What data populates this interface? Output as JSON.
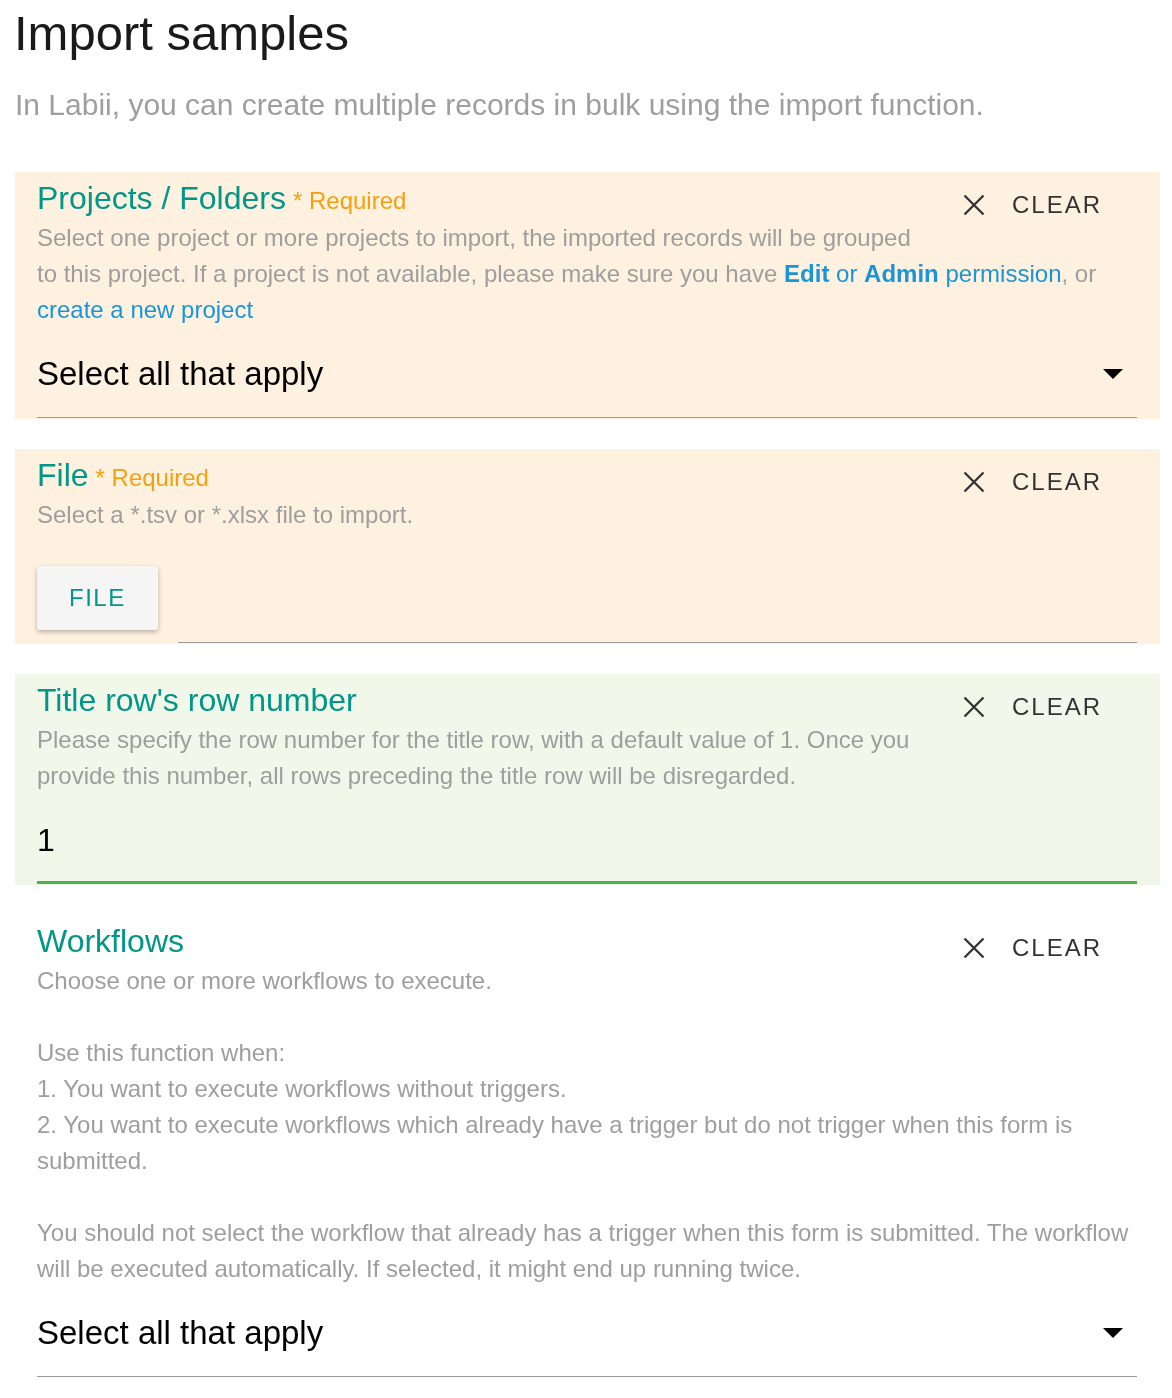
{
  "page": {
    "title": "Import samples",
    "subtitle": "In Labii, you can create multiple records in bulk using the import function."
  },
  "fields": [
    {
      "kind": "select",
      "title": "Projects / Folders",
      "required_label": "* Required",
      "color": "#fef1df",
      "focused": false,
      "clear_label": "CLEAR",
      "description": [
        {
          "kind": "rich",
          "segments": [
            {
              "kind": "text",
              "text": "Select one project or more projects to import, the imported records will be grouped to this project. If a project is not available, please make sure you have "
            },
            {
              "kind": "link",
              "text": "**Edit** or **Admin** permission"
            },
            {
              "kind": "text",
              "text": ", or "
            },
            {
              "kind": "link",
              "text": "create a new project"
            }
          ]
        }
      ],
      "placeholder": "Select all that apply"
    },
    {
      "kind": "file",
      "title": "File",
      "required_label": "* Required",
      "color": "#fef1df",
      "focused": false,
      "clear_label": "CLEAR",
      "description": [
        {
          "kind": "text",
          "lines": [
            "Select a *.tsv or *.xlsx file to import."
          ]
        }
      ],
      "button_label": "FILE"
    },
    {
      "kind": "number",
      "title": "Title row's row number",
      "color": "#f1f8e9",
      "focused": true,
      "clear_label": "CLEAR",
      "description": [
        {
          "kind": "text",
          "lines": [
            "Please specify the row number for the title row, with a default value of 1. Once you provide this number, all rows preceding the title row will be disregarded."
          ]
        }
      ],
      "value": "1"
    },
    {
      "kind": "select",
      "title": "Workflows",
      "color": "#ffffff",
      "focused": false,
      "clear_label": "CLEAR",
      "description": [
        {
          "kind": "text",
          "lines": [
            "Choose one or more workflows to execute."
          ]
        },
        {
          "kind": "text",
          "lines": [
            "Use this function when:",
            "1. You want to execute workflows without triggers.",
            "2. You want to execute workflows which already have a trigger but do not trigger when this form is submitted."
          ]
        },
        {
          "kind": "text",
          "lines": [
            "You should not select the workflow that already has a trigger when this form is submitted. The workflow will be executed automatically. If selected, it might end up running twice."
          ]
        }
      ],
      "placeholder": "Select all that apply"
    }
  ]
}
